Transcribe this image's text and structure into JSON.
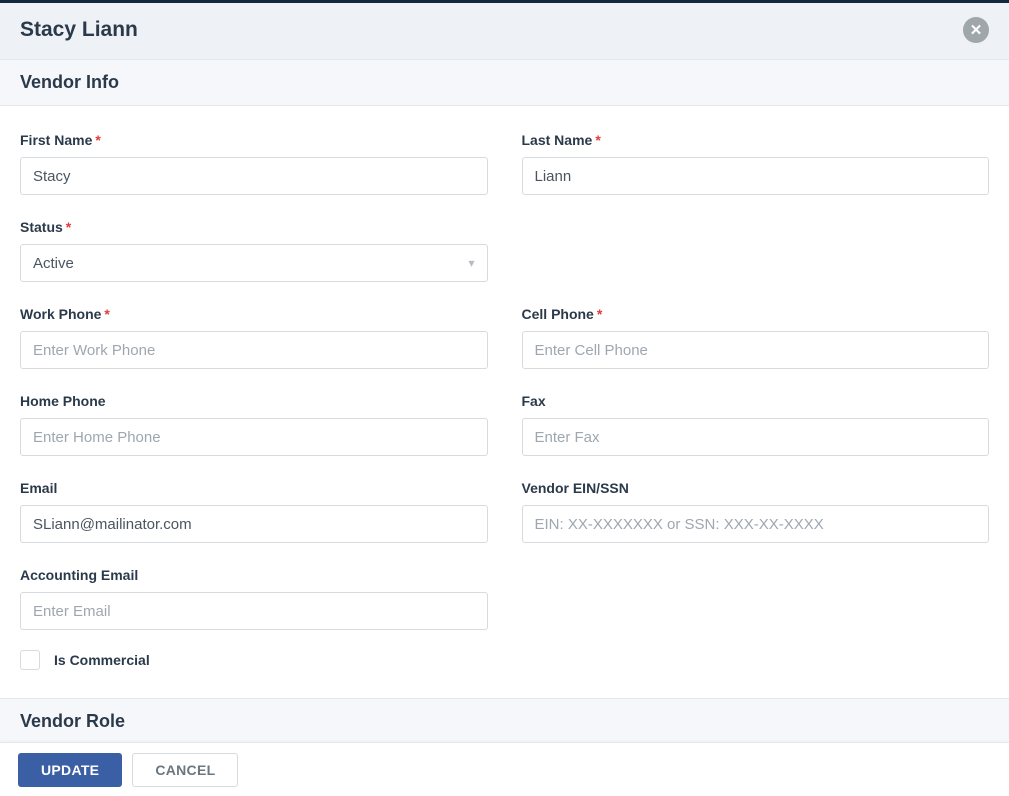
{
  "header": {
    "title": "Stacy Liann"
  },
  "sections": {
    "vendor_info": "Vendor Info",
    "vendor_role": "Vendor Role"
  },
  "fields": {
    "first_name": {
      "label": "First Name",
      "value": "Stacy",
      "required": true
    },
    "last_name": {
      "label": "Last Name",
      "value": "Liann",
      "required": true
    },
    "status": {
      "label": "Status",
      "value": "Active",
      "required": true
    },
    "work_phone": {
      "label": "Work Phone",
      "value": "",
      "placeholder": "Enter Work Phone",
      "required": true
    },
    "cell_phone": {
      "label": "Cell Phone",
      "value": "",
      "placeholder": "Enter Cell Phone",
      "required": true
    },
    "home_phone": {
      "label": "Home Phone",
      "value": "",
      "placeholder": "Enter Home Phone",
      "required": false
    },
    "fax": {
      "label": "Fax",
      "value": "",
      "placeholder": "Enter Fax",
      "required": false
    },
    "email": {
      "label": "Email",
      "value": "SLiann@mailinator.com",
      "required": false
    },
    "ein": {
      "label": "Vendor EIN/SSN",
      "value": "",
      "placeholder": "EIN: XX-XXXXXXX or SSN: XXX-XX-XXXX",
      "required": false
    },
    "acct_email": {
      "label": "Accounting Email",
      "value": "",
      "placeholder": "Enter Email",
      "required": false
    },
    "is_commercial": {
      "label": "Is Commercial",
      "checked": false
    }
  },
  "footer": {
    "update": "UPDATE",
    "cancel": "CANCEL"
  },
  "required_marker": "*"
}
